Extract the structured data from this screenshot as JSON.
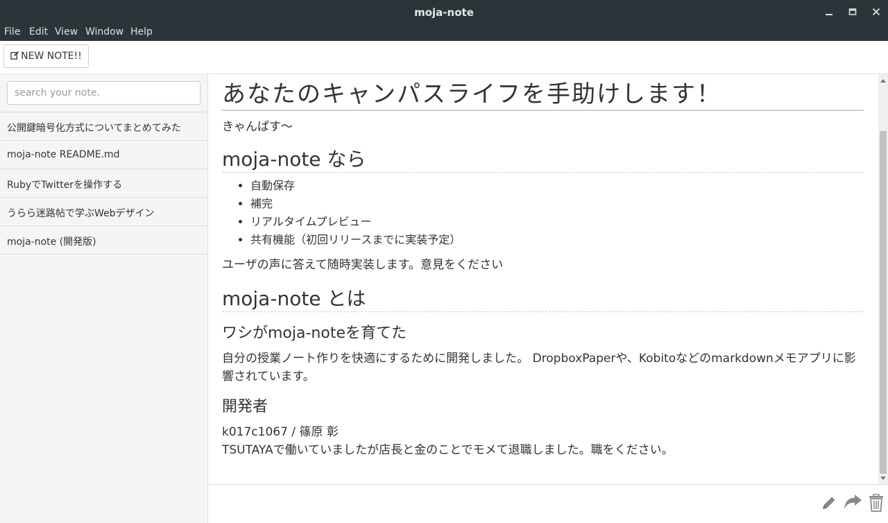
{
  "window": {
    "title": "moja-note"
  },
  "menu": [
    "File",
    "Edit",
    "View",
    "Window",
    "Help"
  ],
  "toolbar": {
    "new_note_label": "NEW NOTE!!"
  },
  "sidebar": {
    "search_placeholder": "search your note.",
    "notes": [
      "公開鍵暗号化方式についてまとめてみた",
      "moja-note README.md",
      "RubyでTwitterを操作する",
      "うらら迷路帖で学ぶWebデザイン",
      "moja-note (開発版)"
    ]
  },
  "document": {
    "h1": "あなたのキャンパスライフを手助けします！",
    "subtitle": "きゃんぱす〜",
    "section1_title": "moja-note なら",
    "features": [
      "自動保存",
      "補完",
      "リアルタイムプレビュー",
      "共有機能（初回リリースまでに実装予定）"
    ],
    "feedback": "ユーザの声に答えて随時実装します。意見をください",
    "section2_title": "moja-note とは",
    "sub1_title": "ワシがmoja-noteを育てた",
    "sub1_body": "自分の授業ノート作りを快適にするために開発しました。 DropboxPaperや、Kobitoなどのmarkdownメモアプリに影響されています。",
    "sub2_title": "開発者",
    "dev_id": "k017c1067 / 篠原 彰",
    "dev_note": "TSUTAYAで働いていましたが店長と金のことでモメて退職しました。職をください。"
  },
  "icons": {
    "minimize": "minimize-icon",
    "maximize": "maximize-icon",
    "close": "close-icon",
    "edit": "pencil-icon",
    "share": "share-icon",
    "delete": "trash-icon"
  },
  "colors": {
    "titlebar": "#2b3439",
    "icon": "#888888"
  }
}
